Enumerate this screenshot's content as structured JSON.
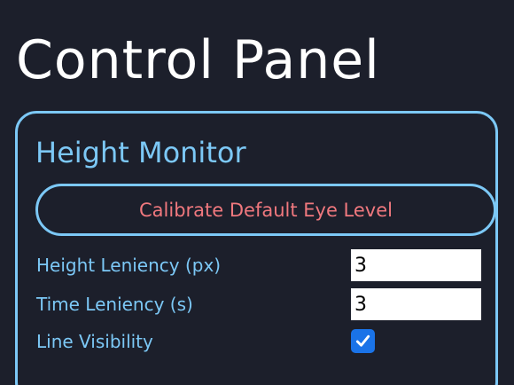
{
  "page": {
    "title": "Control Panel"
  },
  "height_monitor": {
    "title": "Height Monitor",
    "calibrate_button_label": "Calibrate Default Eye Level",
    "height_leniency": {
      "label": "Height Leniency (px)",
      "value": "3"
    },
    "time_leniency": {
      "label": "Time Leniency (s)",
      "value": "3"
    },
    "line_visibility": {
      "label": "Line Visibility",
      "checked": true
    }
  },
  "colors": {
    "background": "#1c1f2b",
    "accent": "#7cc8f6",
    "button_text": "#f0787e",
    "checkbox": "#1a73e8"
  },
  "icons": {
    "checkbox_check": "checkmark-icon"
  }
}
